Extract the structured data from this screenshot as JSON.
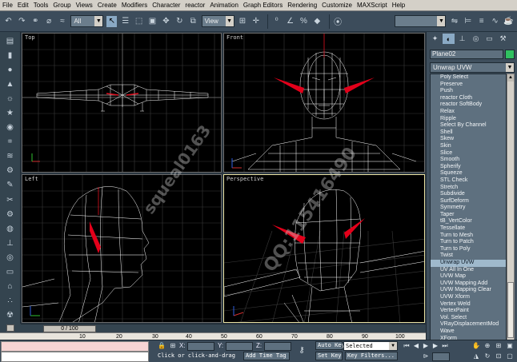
{
  "menu": [
    "File",
    "Edit",
    "Tools",
    "Group",
    "Views",
    "Create",
    "Modifiers",
    "Character",
    "reactor",
    "Animation",
    "Graph Editors",
    "Rendering",
    "Customize",
    "MAXScript",
    "Help"
  ],
  "toolbar": {
    "selection_filter": "All",
    "ref_coord": "View"
  },
  "viewports": {
    "top_left": "Top",
    "top_right": "Front",
    "bottom_left": "Left",
    "bottom_right": "Perspective"
  },
  "command_panel": {
    "object_name": "Plane02",
    "object_color": "#30c060",
    "modifier_list_label": "Unwrap UVW",
    "modifiers": [
      "Poly Select",
      "Preserve",
      "Push",
      "reactor Cloth",
      "reactor SoftBody",
      "Relax",
      "Ripple",
      "Select By Channel",
      "Shell",
      "Skew",
      "Skin",
      "Slice",
      "Smooth",
      "Spherify",
      "Squeeze",
      "STL Check",
      "Stretch",
      "Subdivide",
      "SurfDeform",
      "Symmetry",
      "Taper",
      "tB_VertColor",
      "Tessellate",
      "Turn to Mesh",
      "Turn to Patch",
      "Turn to Poly",
      "Twist",
      "Unwrap UVW",
      "UV All In One",
      "UVW Map",
      "UVW Mapping Add",
      "UVW Mapping Clear",
      "UVW Xform",
      "Vertex Weld",
      "VertexPaint",
      "Vol. Select",
      "VRayDisplacementMod",
      "Wave",
      "XForm"
    ],
    "selected_modifier": "Unwrap UVW"
  },
  "timeline": {
    "slider": "0 / 100",
    "ticks": [
      "10",
      "20",
      "30",
      "40",
      "50",
      "60",
      "70",
      "80",
      "90",
      "100"
    ]
  },
  "status": {
    "x_label": "X:",
    "y_label": "Y:",
    "z_label": "Z:",
    "prompt": "Click or click-and-drag",
    "add_time_tag": "Add Time Tag",
    "auto_key": "Auto Key",
    "set_key": "Set Key",
    "selected": "Selected",
    "key_filters": "Key Filters..."
  },
  "watermark": {
    "line1": "squeal0163",
    "line2": "QQ:115416490"
  }
}
